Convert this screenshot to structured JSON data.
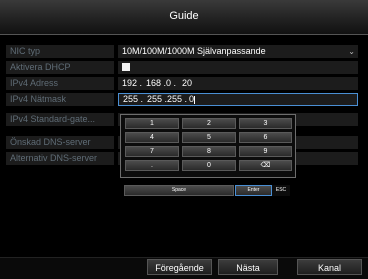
{
  "title": "Guide",
  "fields": [
    {
      "label": "NIC typ",
      "value": "10M/100M/1000M Självanpassande"
    },
    {
      "label": "Aktivera DHCP"
    },
    {
      "label": "IPv4 Adress",
      "ip": [
        "192",
        "168",
        "0",
        "20"
      ]
    },
    {
      "label": "IPv4 Nätmask",
      "ip": [
        "255",
        "255",
        "255",
        "0"
      ]
    },
    {
      "label": "IPv4 Standard-gate..."
    },
    {
      "label": "Önskad DNS-server"
    },
    {
      "label": "Alternativ DNS-server"
    }
  ],
  "keypad": {
    "row1": [
      "1",
      "2",
      "3"
    ],
    "row2": [
      "4",
      "5",
      "6"
    ],
    "row3": [
      "7",
      "8",
      "9"
    ],
    "row4": [
      ".",
      "0",
      "⌫"
    ],
    "space": "Space",
    "enter": "Enter",
    "esc": "ESC"
  },
  "buttons": {
    "previous": "Föregående",
    "next": "Nästa",
    "cancel": "Kanal"
  },
  "colors": {
    "accent": "#4a8fd4",
    "label_text": "#5f6c76"
  }
}
